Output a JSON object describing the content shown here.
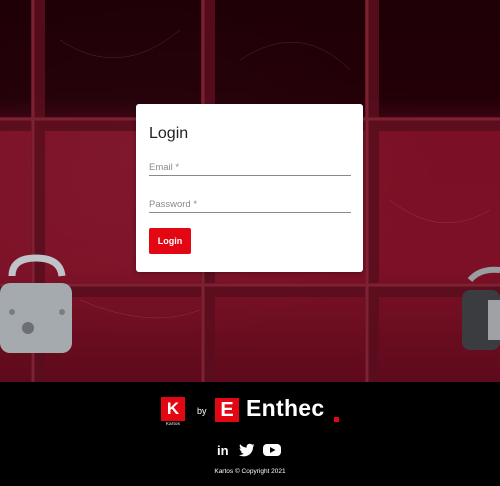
{
  "login": {
    "title": "Login",
    "email_placeholder": "Email *",
    "email_value": "",
    "password_placeholder": "Password *",
    "password_value": "",
    "button_label": "Login"
  },
  "footer": {
    "kartos_mark": "K",
    "kartos_name": "Kartos",
    "by_text": "by",
    "enthec_mark": "E",
    "enthec_name": "Enthec",
    "social": [
      {
        "icon": "linkedin-icon",
        "label": "in"
      },
      {
        "icon": "twitter-icon"
      },
      {
        "icon": "youtube-icon"
      }
    ],
    "copyright": "Kartos © Copyright 2021"
  },
  "colors": {
    "accent": "#e30613",
    "footer_bg": "#000000",
    "card_bg": "#ffffff"
  }
}
